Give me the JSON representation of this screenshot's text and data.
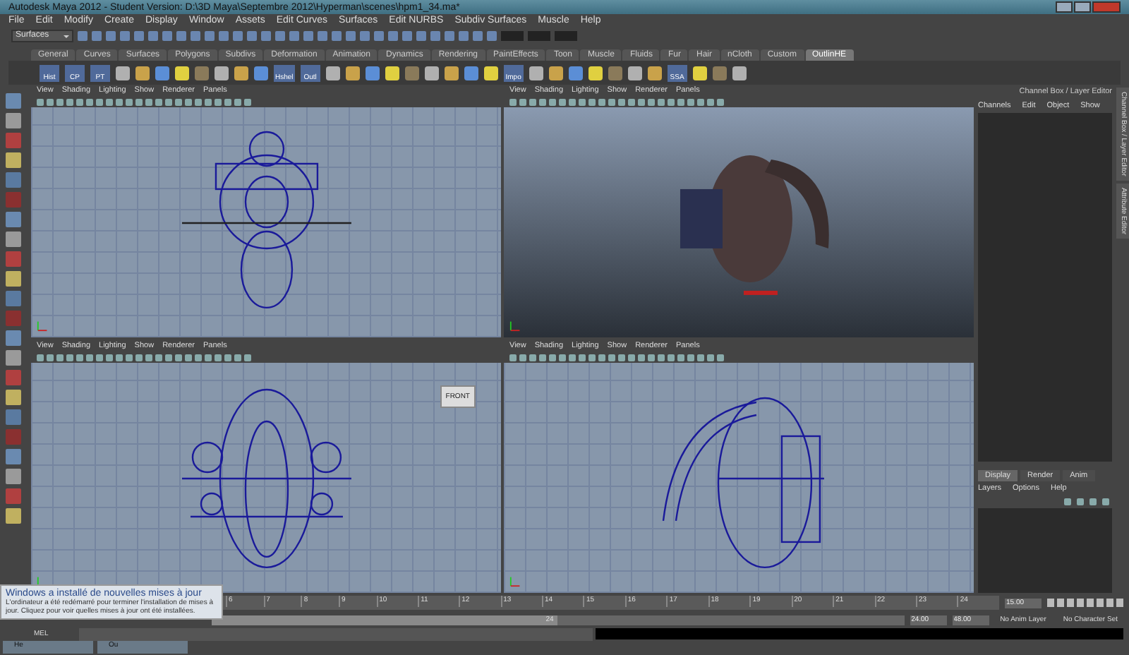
{
  "window": {
    "title": "Autodesk Maya 2012 - Student Version: D:\\3D Maya\\Septembre 2012\\Hyperman\\scenes\\hpm1_34.ma*"
  },
  "menu": [
    "File",
    "Edit",
    "Modify",
    "Create",
    "Display",
    "Window",
    "Assets",
    "Edit Curves",
    "Surfaces",
    "Edit NURBS",
    "Subdiv Surfaces",
    "Muscle",
    "Help"
  ],
  "status_line": {
    "mode": "Surfaces"
  },
  "shelf_tabs": [
    {
      "label": "General",
      "selected": false
    },
    {
      "label": "Curves",
      "selected": false
    },
    {
      "label": "Surfaces",
      "selected": false
    },
    {
      "label": "Polygons",
      "selected": false
    },
    {
      "label": "Subdivs",
      "selected": false
    },
    {
      "label": "Deformation",
      "selected": false
    },
    {
      "label": "Animation",
      "selected": false
    },
    {
      "label": "Dynamics",
      "selected": false
    },
    {
      "label": "Rendering",
      "selected": false
    },
    {
      "label": "PaintEffects",
      "selected": false
    },
    {
      "label": "Toon",
      "selected": false
    },
    {
      "label": "Muscle",
      "selected": false
    },
    {
      "label": "Fluids",
      "selected": false
    },
    {
      "label": "Fur",
      "selected": false
    },
    {
      "label": "Hair",
      "selected": false
    },
    {
      "label": "nCloth",
      "selected": false
    },
    {
      "label": "Custom",
      "selected": false
    },
    {
      "label": "OutlinHE",
      "selected": true
    }
  ],
  "shelf_labels": [
    "Hist",
    "CP",
    "PT",
    "Hshel",
    "Outl",
    "Impo",
    "SSA"
  ],
  "viewports": [
    {
      "kind": "top",
      "menu": [
        "View",
        "Shading",
        "Lighting",
        "Show",
        "Renderer",
        "Panels"
      ]
    },
    {
      "kind": "shaded",
      "menu": [
        "View",
        "Shading",
        "Lighting",
        "Show",
        "Renderer",
        "Panels"
      ]
    },
    {
      "kind": "front",
      "menu": [
        "View",
        "Shading",
        "Lighting",
        "Show",
        "Renderer",
        "Panels"
      ],
      "view_cube": "FRONT"
    },
    {
      "kind": "side",
      "menu": [
        "View",
        "Shading",
        "Lighting",
        "Show",
        "Renderer",
        "Panels"
      ]
    }
  ],
  "channel_box": {
    "title": "Channel Box / Layer Editor",
    "menu": [
      "Channels",
      "Edit",
      "Object",
      "Show"
    ]
  },
  "layer_editor": {
    "tabs": [
      {
        "label": "Display",
        "selected": true
      },
      {
        "label": "Render",
        "selected": false
      },
      {
        "label": "Anim",
        "selected": false
      }
    ],
    "menu": [
      "Layers",
      "Options",
      "Help"
    ]
  },
  "side_tabs": [
    "Channel Box / Layer Editor",
    "Attribute Editor"
  ],
  "timeline": {
    "ticks": [
      "6",
      "7",
      "8",
      "9",
      "10",
      "11",
      "12",
      "13",
      "14",
      "15",
      "16",
      "17",
      "18",
      "19",
      "20",
      "21",
      "22",
      "23",
      "24"
    ],
    "current_time": "15.00"
  },
  "range": {
    "level": 0.5,
    "slider_end": "24",
    "end_time": "24.00",
    "total_end": "48.00",
    "anim_layer": "No Anim Layer",
    "character_set": "No Character Set"
  },
  "command_line": {
    "label": "MEL"
  },
  "notification": {
    "title": "Windows a installé de nouvelles mises à jour",
    "body": "L'ordinateur a été redémarré pour terminer l'installation de mises à jour. Cliquez pour voir quelles mises à jour ont été installées."
  },
  "minimized_windows": [
    "He",
    "Ou"
  ]
}
